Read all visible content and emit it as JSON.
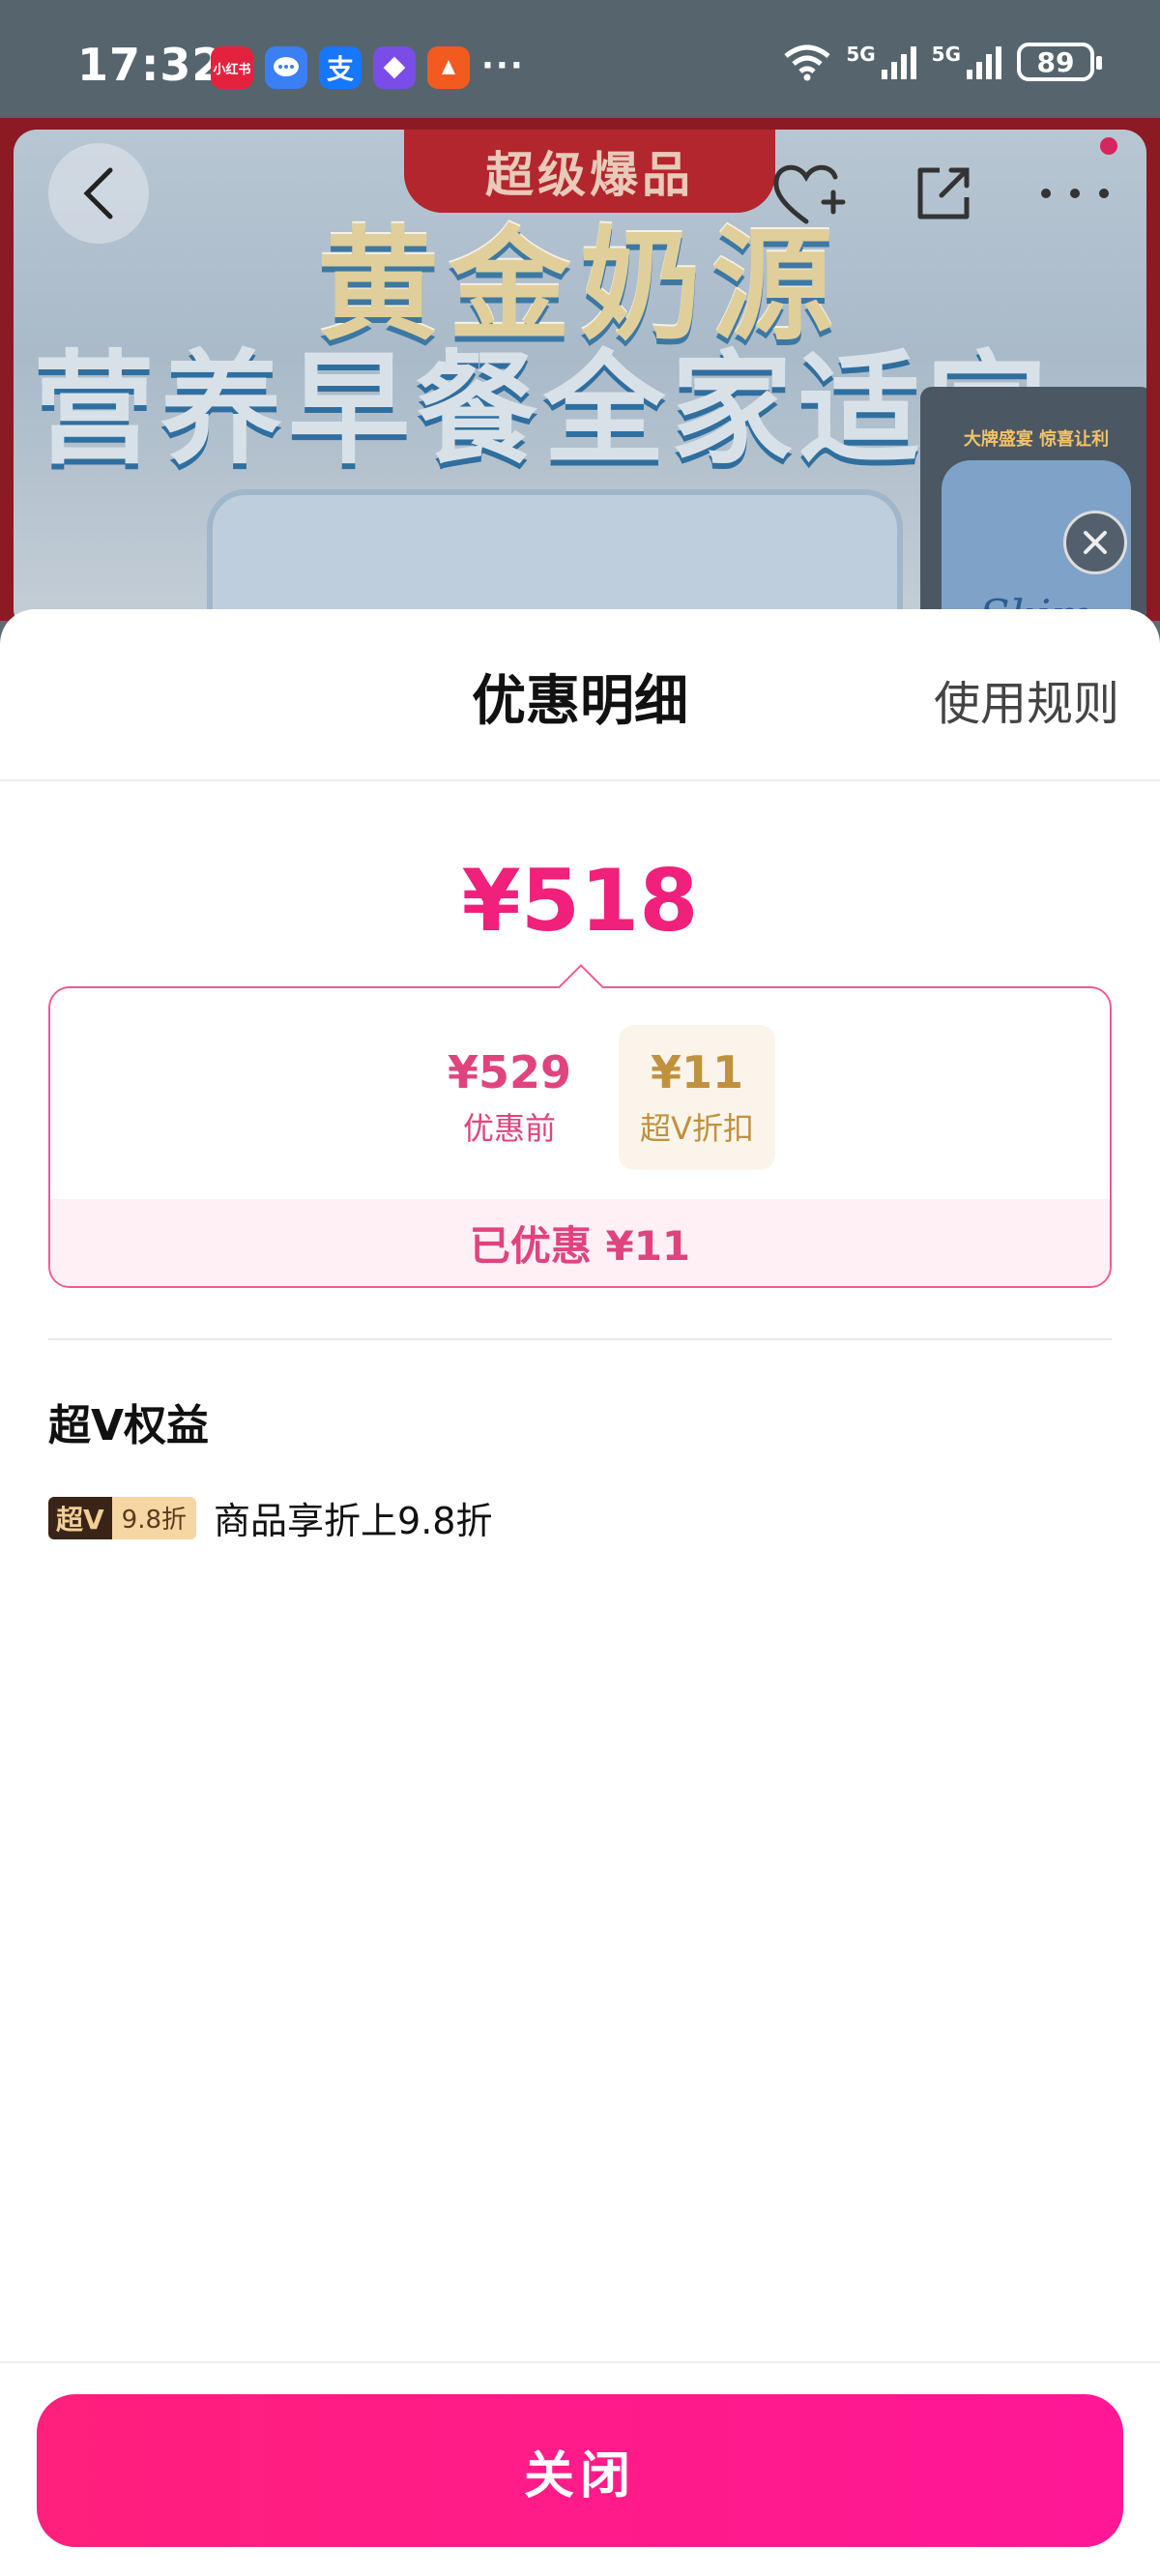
{
  "status_bar": {
    "time": "17:32",
    "apps": [
      {
        "icon": "xiaohongshu-icon",
        "text": "小红书",
        "color": "#e5223e"
      },
      {
        "icon": "message-icon",
        "text": "",
        "color": "#3b7ff5"
      },
      {
        "icon": "alipay-icon",
        "text": "支",
        "color": "#1677ff"
      },
      {
        "icon": "app-diamond-icon",
        "text": "",
        "color": "#7b4de8"
      },
      {
        "icon": "app-orange-icon",
        "text": "",
        "color": "#f25a1f"
      }
    ],
    "more": "···",
    "network_1": "5G",
    "network_2": "5G",
    "battery": "89"
  },
  "banner": {
    "ribbon": "超级爆品",
    "line1": "黄金奶源",
    "line2": "营养早餐全家适宜",
    "mini_caption": "大牌盛宴 惊喜让利",
    "mini_brand": "Skim"
  },
  "sheet": {
    "title": "优惠明细",
    "rules": "使用规则",
    "final_price": "¥518",
    "original_price": "¥529",
    "original_label": "优惠前",
    "minus": "-",
    "discount_value": "¥11",
    "discount_label": "超V折扣",
    "saved": "已优惠 ¥11",
    "perks_title": "超V权益",
    "perk_badge_vip": "超V",
    "perk_badge_rate": "9.8折",
    "perk_desc": "商品享折上9.8折",
    "close": "关闭"
  },
  "colors": {
    "accent": "#f0207b",
    "discount_gold": "#c1913e"
  }
}
